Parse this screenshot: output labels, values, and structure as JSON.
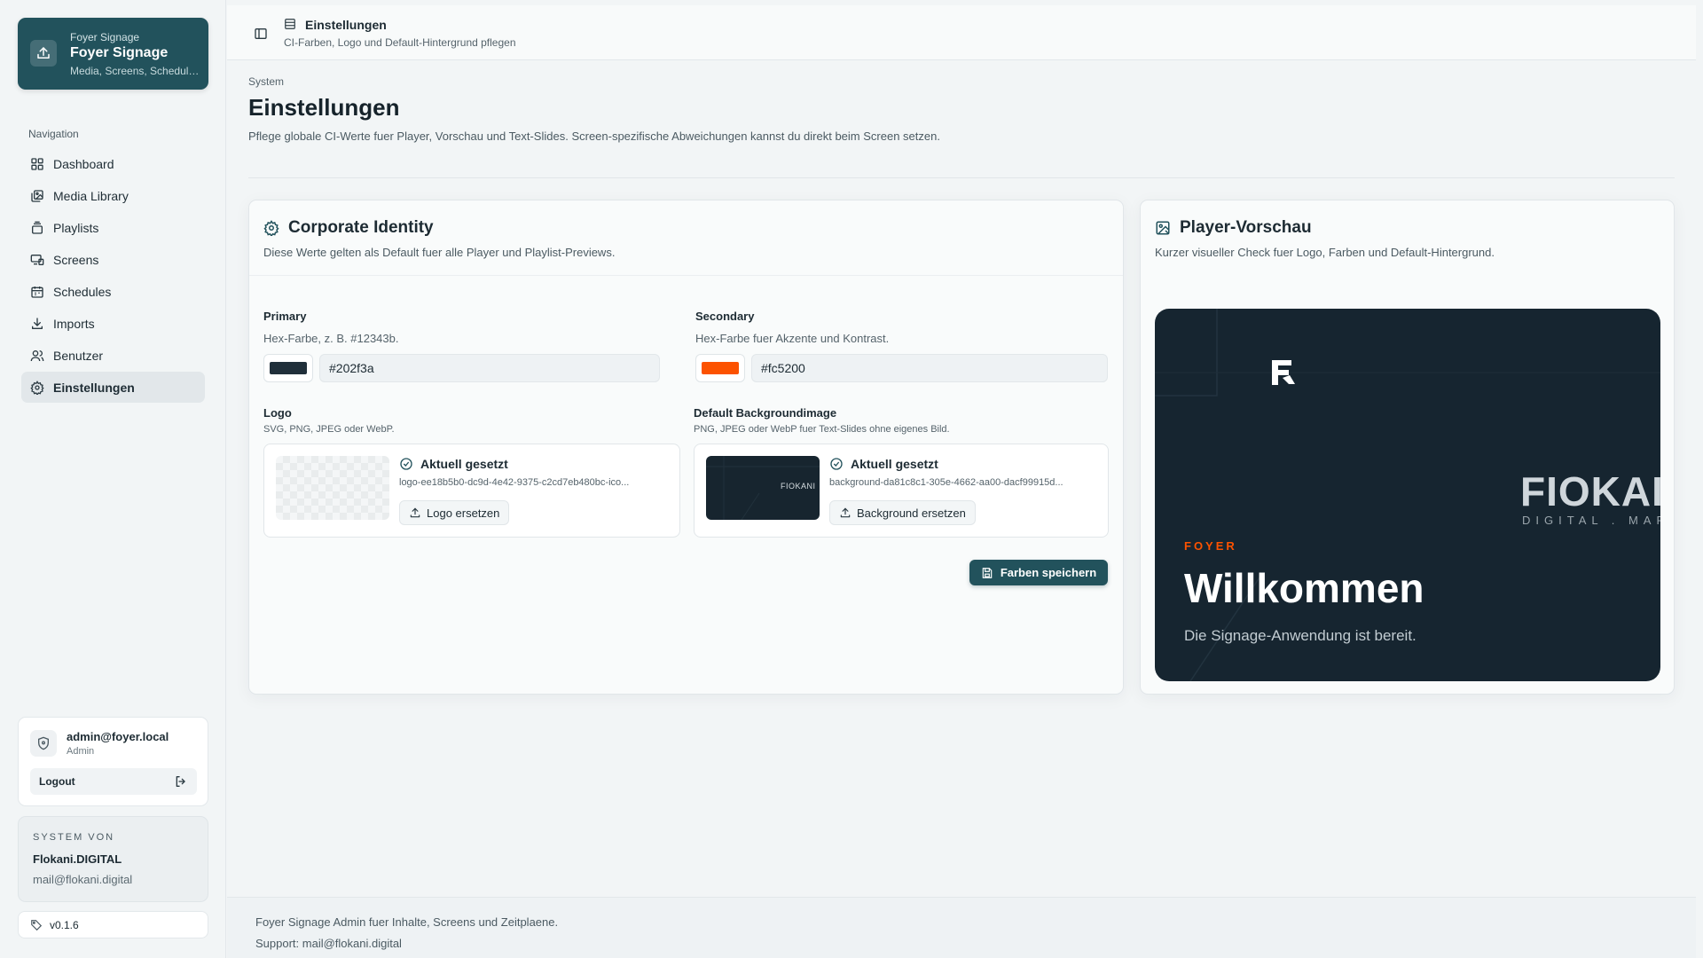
{
  "brand": {
    "small": "Foyer Signage",
    "title": "Foyer Signage",
    "subtitle": "Media, Screens, Schedul…"
  },
  "nav": {
    "heading": "Navigation",
    "items": [
      {
        "label": "Dashboard",
        "icon": "dashboard-icon"
      },
      {
        "label": "Media Library",
        "icon": "media-library-icon"
      },
      {
        "label": "Playlists",
        "icon": "playlists-icon"
      },
      {
        "label": "Screens",
        "icon": "screens-icon"
      },
      {
        "label": "Schedules",
        "icon": "schedules-icon"
      },
      {
        "label": "Imports",
        "icon": "imports-icon"
      },
      {
        "label": "Benutzer",
        "icon": "users-icon"
      },
      {
        "label": "Einstellungen",
        "icon": "settings-icon",
        "active": true
      }
    ]
  },
  "user": {
    "email": "admin@foyer.local",
    "role": "Admin",
    "logout_label": "Logout"
  },
  "system": {
    "label": "SYSTEM VON",
    "company": "Flokani.DIGITAL",
    "mail": "mail@flokani.digital"
  },
  "version": "v0.1.6",
  "topbar": {
    "title": "Einstellungen",
    "subtitle": "CI-Farben, Logo und Default-Hintergrund pflegen"
  },
  "page": {
    "crumb": "System",
    "title": "Einstellungen",
    "description": "Pflege globale CI-Werte fuer Player, Vorschau und Text-Slides. Screen-spezifische Abweichungen kannst du direkt beim Screen setzen."
  },
  "ci": {
    "title": "Corporate Identity",
    "description": "Diese Werte gelten als Default fuer alle Player und Playlist-Previews.",
    "primary": {
      "label": "Primary",
      "hint": "Hex-Farbe, z. B. #12343b.",
      "value": "#202f3a",
      "color": "#202f3a"
    },
    "secondary": {
      "label": "Secondary",
      "hint": "Hex-Farbe fuer Akzente und Kontrast.",
      "value": "#fc5200",
      "color": "#fc5200"
    },
    "logo": {
      "label": "Logo",
      "hint": "SVG, PNG, JPEG oder WebP.",
      "status": "Aktuell gesetzt",
      "file": "logo-ee18b5b0-dc9d-4e42-9375-c2cd7eb480bc-ico...",
      "button": "Logo ersetzen"
    },
    "background": {
      "label": "Default Backgroundimage",
      "hint": "PNG, JPEG oder WebP fuer Text-Slides ohne eigenes Bild.",
      "status": "Aktuell gesetzt",
      "file": "background-da81c8c1-305e-4662-aa00-dacf99915d...",
      "button": "Background ersetzen",
      "thumb_text": "FIOKANI"
    },
    "save_label": "Farben speichern"
  },
  "preview": {
    "title": "Player-Vorschau",
    "description": "Kurzer visueller Check fuer Logo, Farben und Default-Hintergrund.",
    "brand_word": "FIOKAI",
    "brand_tag": "DIGITAL . MARK",
    "kicker": "FOYER",
    "headline": "Willkommen",
    "subline": "Die Signage-Anwendung ist bereit.",
    "accent_color": "#fc5200"
  },
  "footer": {
    "line1": "Foyer Signage Admin fuer Inhalte, Screens und Zeitplaene.",
    "line2": "Support: mail@flokani.digital"
  }
}
